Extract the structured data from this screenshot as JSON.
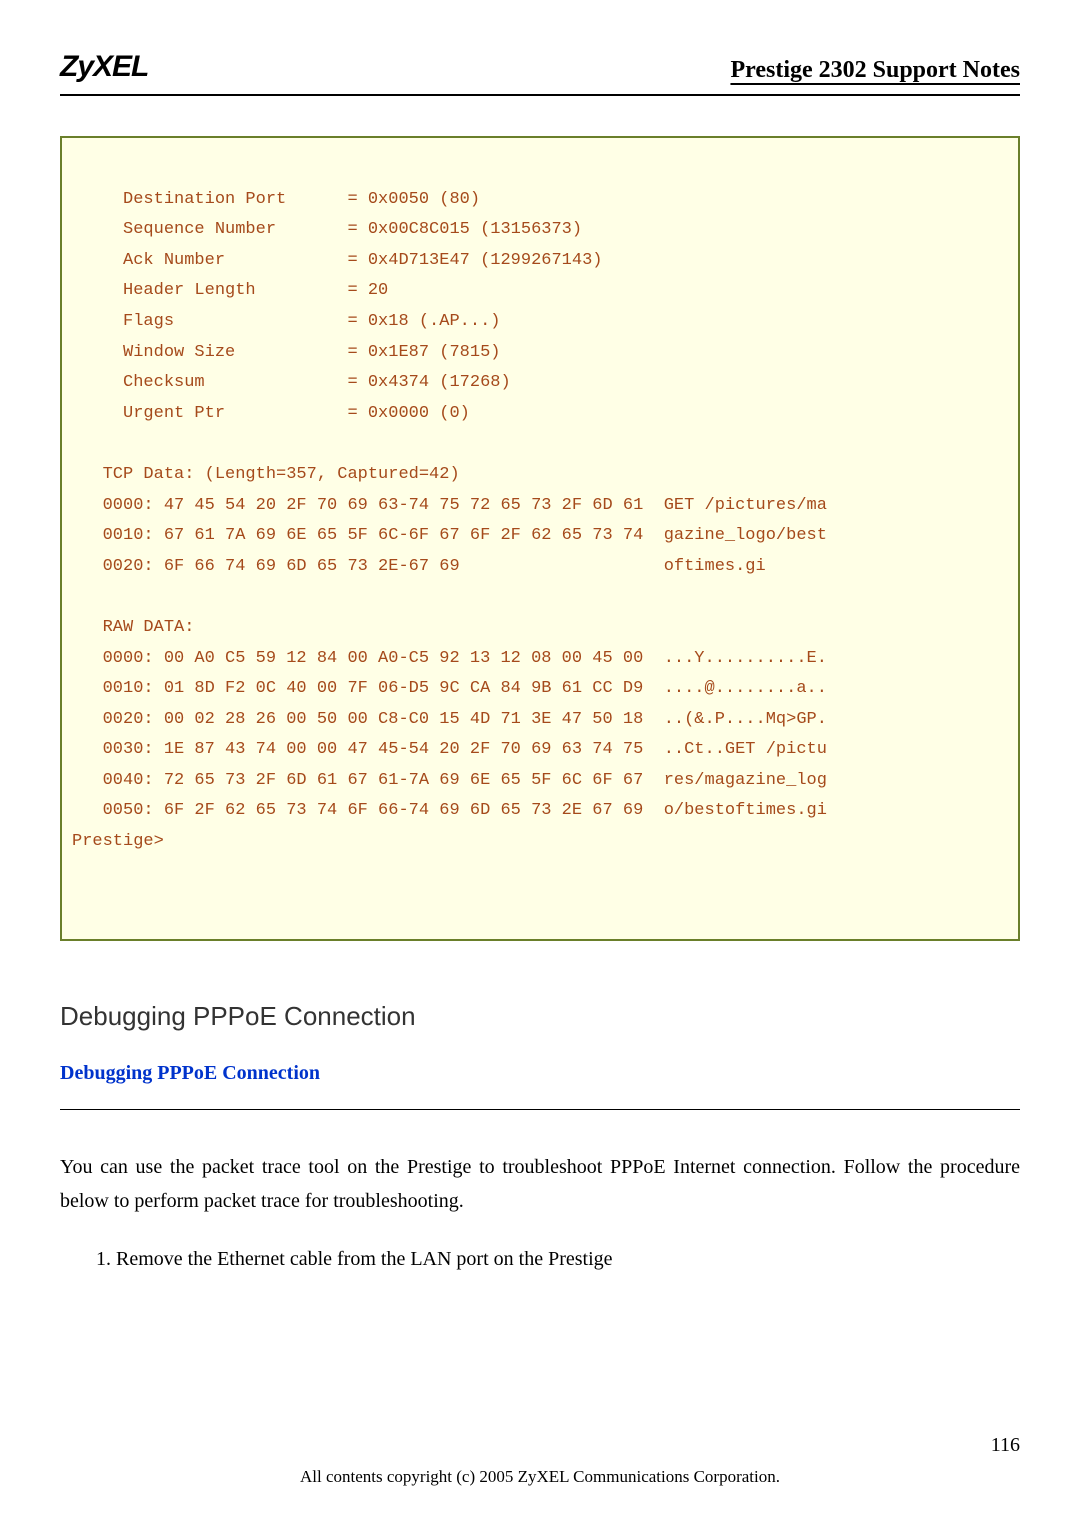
{
  "header": {
    "logo": "ZyXEL",
    "title": "Prestige 2302 Support Notes"
  },
  "code": {
    "lines": [
      "     Destination Port      = 0x0050 (80)",
      "     Sequence Number       = 0x00C8C015 (13156373)",
      "     Ack Number            = 0x4D713E47 (1299267143)",
      "     Header Length         = 20",
      "     Flags                 = 0x18 (.AP...)",
      "     Window Size           = 0x1E87 (7815)",
      "     Checksum              = 0x4374 (17268)",
      "     Urgent Ptr            = 0x0000 (0)",
      "",
      "   TCP Data: (Length=357, Captured=42)",
      "   0000: 47 45 54 20 2F 70 69 63-74 75 72 65 73 2F 6D 61  GET /pictures/ma",
      "   0010: 67 61 7A 69 6E 65 5F 6C-6F 67 6F 2F 62 65 73 74  gazine_logo/best",
      "   0020: 6F 66 74 69 6D 65 73 2E-67 69                    oftimes.gi",
      "",
      "   RAW DATA:",
      "   0000: 00 A0 C5 59 12 84 00 A0-C5 92 13 12 08 00 45 00  ...Y..........E.",
      "   0010: 01 8D F2 0C 40 00 7F 06-D5 9C CA 84 9B 61 CC D9  ....@........a..",
      "   0020: 00 02 28 26 00 50 00 C8-C0 15 4D 71 3E 47 50 18  ..(&.P....Mq>GP.",
      "   0030: 1E 87 43 74 00 00 47 45-54 20 2F 70 69 63 74 75  ..Ct..GET /pictu",
      "   0040: 72 65 73 2F 6D 61 67 61-7A 69 6E 65 5F 6C 6F 67  res/magazine_log",
      "   0050: 6F 2F 62 65 73 74 6F 66-74 69 6D 65 73 2E 67 69  o/bestoftimes.gi",
      "Prestige>",
      "",
      ""
    ]
  },
  "section": {
    "heading": "Debugging PPPoE Connection",
    "subheading": "Debugging PPPoE Connection",
    "body": "You can use the packet trace tool on the Prestige to troubleshoot PPPoE Internet connection. Follow the procedure below to perform packet trace for troubleshooting.",
    "list1": "1.   Remove the Ethernet cable from the LAN port on the Prestige"
  },
  "footer": {
    "page": "116",
    "copyright": "All contents copyright (c) 2005 ZyXEL Communications Corporation."
  }
}
